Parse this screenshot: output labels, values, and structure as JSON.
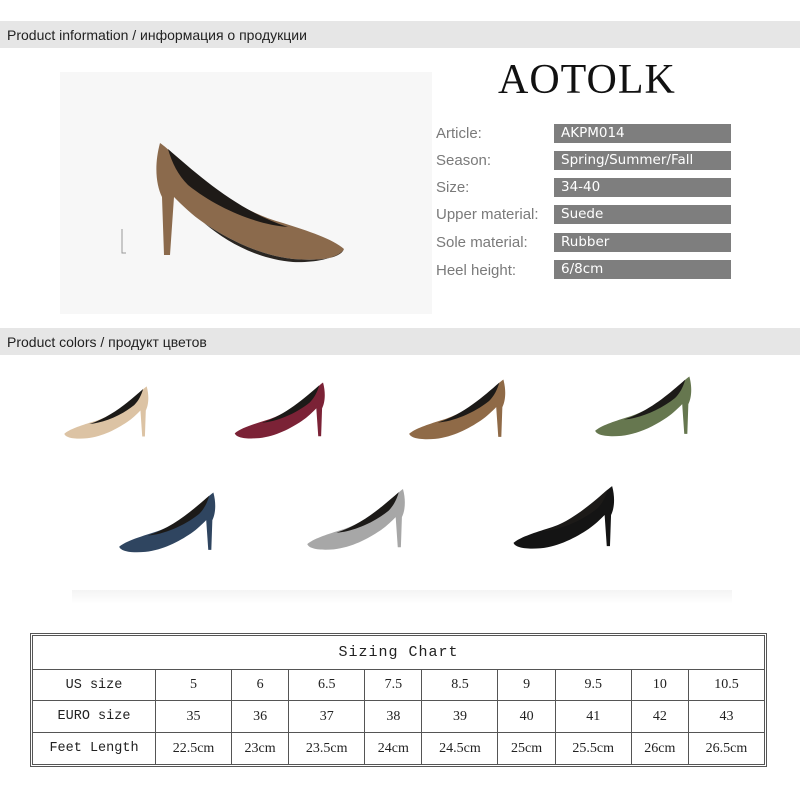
{
  "sections": {
    "info_title": "Product information / информация о продукции",
    "colors_title": "Product colors / продукт цветов"
  },
  "brand": "AOTOLK",
  "specs": [
    {
      "label": "Article:",
      "value": "AKPM014"
    },
    {
      "label": "Season:",
      "value": "Spring/Summer/Fall"
    },
    {
      "label": "Size:",
      "value": "34-40"
    },
    {
      "label": "Upper material:",
      "value": "Suede"
    },
    {
      "label": "Sole material:",
      "value": "Rubber"
    },
    {
      "label": "Heel height:",
      "value": "6/8cm"
    }
  ],
  "colors": {
    "main": "#8b6a4c",
    "beige": "#dcc3a4",
    "wine": "#7b2236",
    "brown": "#8f6a47",
    "olive": "#66774f",
    "navy": "#2f4560",
    "grey": "#a7a7a7",
    "black": "#141414",
    "spec_bg": "#7e7e7e",
    "bar_bg": "#e6e6e6"
  },
  "sizing_chart": {
    "title": "Sizing Chart",
    "rows": [
      {
        "label": "US size",
        "values": [
          "5",
          "6",
          "6.5",
          "7.5",
          "8.5",
          "9",
          "9.5",
          "10",
          "10.5"
        ]
      },
      {
        "label": "EURO size",
        "values": [
          "35",
          "36",
          "37",
          "38",
          "39",
          "40",
          "41",
          "42",
          "43"
        ]
      },
      {
        "label": "Feet Length",
        "values": [
          "22.5cm",
          "23cm",
          "23.5cm",
          "24cm",
          "24.5cm",
          "25cm",
          "25.5cm",
          "26cm",
          "26.5cm"
        ]
      }
    ]
  }
}
